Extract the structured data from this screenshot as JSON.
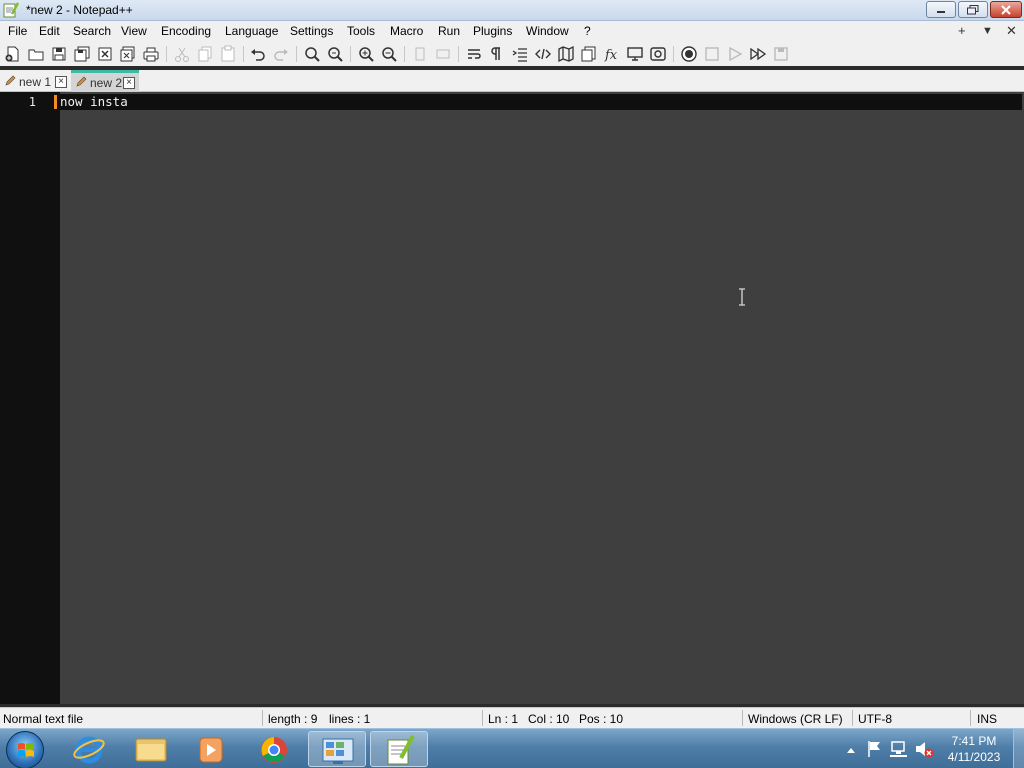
{
  "window": {
    "title": "*new 2 - Notepad++"
  },
  "menu": {
    "items": [
      "File",
      "Edit",
      "Search",
      "View",
      "Encoding",
      "Language",
      "Settings",
      "Tools",
      "Macro",
      "Run",
      "Plugins",
      "Window",
      "?"
    ],
    "right": [
      "+",
      "▼",
      "✕"
    ]
  },
  "toolbar": {
    "icons": [
      "new-file-icon",
      "open-file-icon",
      "save-icon",
      "save-all-icon",
      "close-icon",
      "close-all-icon",
      "print-icon",
      "cut-icon",
      "copy-icon",
      "paste-icon",
      "undo-icon",
      "redo-icon",
      "find-icon",
      "replace-icon",
      "zoom-in-icon",
      "zoom-out-icon",
      "sync-vertical-icon",
      "sync-horizontal-icon",
      "word-wrap-icon",
      "show-all-chars-icon",
      "indent-guide-icon",
      "xml-tag-icon",
      "document-map-icon",
      "function-list-icon",
      "fx-icon",
      "monitor-icon",
      "folder-workspace-icon",
      "record-macro-icon",
      "stop-record-icon",
      "play-macro-icon",
      "run-macro-multiple-icon",
      "save-macro-icon"
    ]
  },
  "tabs": [
    {
      "label": "new 1",
      "active": false
    },
    {
      "label": "new 2",
      "active": true
    }
  ],
  "editor": {
    "line_number": "1",
    "text": "now insta"
  },
  "status": {
    "file_type": "Normal text file",
    "length": "length : 9",
    "lines": "lines : 1",
    "ln": "Ln : 1",
    "col": "Col : 10",
    "pos": "Pos : 10",
    "eol": "Windows (CR LF)",
    "encoding": "UTF-8",
    "mode": "INS"
  },
  "taskbar": {
    "apps": [
      "internet-explorer",
      "file-explorer",
      "media-player",
      "chrome",
      "control-panel",
      "notepad-plus-plus"
    ],
    "time": "7:41 PM",
    "date": "4/11/2023"
  },
  "colors": {
    "editor_bg": "#3f3f3f",
    "gutter_bg": "#101010",
    "caret": "#f28c28",
    "tab_accent": "#3fb9a4"
  }
}
